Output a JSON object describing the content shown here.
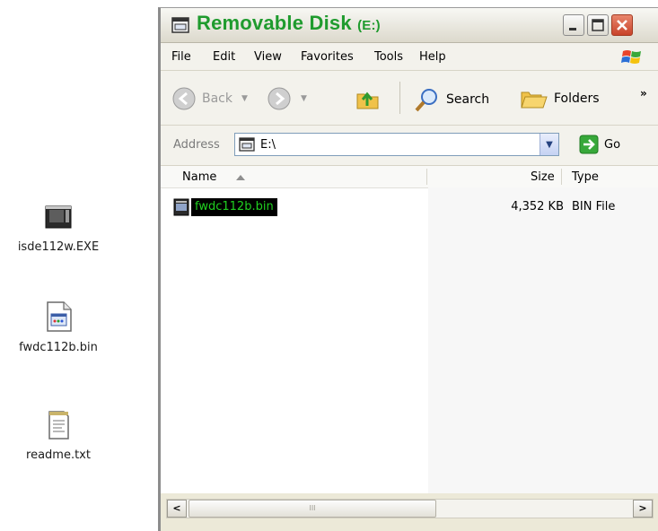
{
  "desktop": {
    "icons": [
      {
        "label": "isde112w.EXE",
        "icon": "exe-installer-icon"
      },
      {
        "label": "fwdc112b.bin",
        "icon": "bin-file-icon"
      },
      {
        "label": "readme.txt",
        "icon": "text-file-icon"
      }
    ]
  },
  "window": {
    "title": "Removable Disk",
    "title_sub": "(E:)",
    "menu": [
      "File",
      "Edit",
      "View",
      "Favorites",
      "Tools",
      "Help"
    ],
    "toolbar": {
      "back": "Back",
      "search": "Search",
      "folders": "Folders",
      "more": "»"
    },
    "address": {
      "label": "Address",
      "value": "E:\\",
      "go": "Go"
    },
    "columns": {
      "name": "Name",
      "size": "Size",
      "type": "Type"
    },
    "files": [
      {
        "name": "fwdc112b.bin",
        "size": "4,352 KB",
        "type": "BIN File",
        "selected": true
      }
    ],
    "scrollbar": {
      "left": "<",
      "right": ">",
      "grip": "III"
    }
  },
  "colors": {
    "title_green": "#1f9b2e",
    "selection_bg": "#000000",
    "selection_text": "#20d020"
  }
}
